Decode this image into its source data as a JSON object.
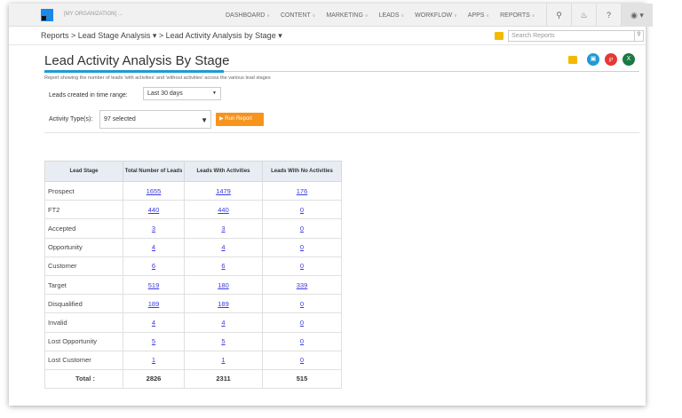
{
  "nav": {
    "org": "[MY ORGANIZATION] ...",
    "menu": [
      "DASHBOARD",
      "CONTENT",
      "MARKETING",
      "LEADS",
      "WORKFLOW",
      "APPS",
      "REPORTS"
    ]
  },
  "breadcrumb": {
    "root": "Reports",
    "level1": "Lead Stage Analysis",
    "level2": "Lead Activity Analysis by Stage"
  },
  "search": {
    "placeholder": "Search Reports"
  },
  "page": {
    "title": "Lead Activity Analysis By Stage",
    "subtitle": "Report showing the number of leads 'with activities' and 'without activities' across the various lead stages"
  },
  "filters": {
    "time_label": "Leads created in time range:",
    "time_value": "Last 30 days",
    "activity_label": "Activity Type(s):",
    "activity_value": "97 selected",
    "run_label": "Run Report"
  },
  "table": {
    "headers": [
      "Lead Stage",
      "Total Number of Leads",
      "Leads With Activities",
      "Leads With No Activities"
    ],
    "rows": [
      [
        "Prospect",
        "1655",
        "1479",
        "176"
      ],
      [
        "FT2",
        "440",
        "440",
        "0"
      ],
      [
        "Accepted",
        "3",
        "3",
        "0"
      ],
      [
        "Opportunity",
        "4",
        "4",
        "0"
      ],
      [
        "Customer",
        "6",
        "6",
        "0"
      ],
      [
        "Target",
        "519",
        "180",
        "339"
      ],
      [
        "Disqualified",
        "189",
        "189",
        "0"
      ],
      [
        "Invalid",
        "4",
        "4",
        "0"
      ],
      [
        "Lost Opportunity",
        "5",
        "5",
        "0"
      ],
      [
        "Lost Customer",
        "1",
        "1",
        "0"
      ]
    ],
    "total": [
      "Total :",
      "2826",
      "2311",
      "515"
    ]
  },
  "colors": {
    "accent": "#1e9ad6",
    "run_button": "#f7941d",
    "link": "#3a3adf"
  }
}
